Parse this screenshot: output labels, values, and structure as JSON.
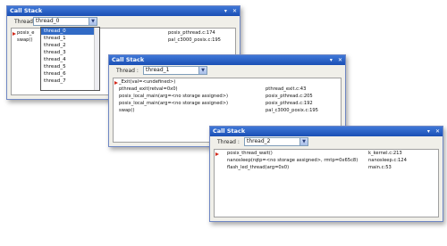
{
  "win1": {
    "title": "Call Stack",
    "thread_label": "Thread :",
    "selected_thread": "thread_0",
    "dropdown_items": [
      "thread_0",
      "thread_1",
      "thread_2",
      "thread_3",
      "thread_4",
      "thread_5",
      "thread_6",
      "thread_7"
    ],
    "rows": [
      {
        "fn": "posix_e",
        "loc": "posix_pthread.c:174"
      },
      {
        "fn": "swap()",
        "loc": "pal_c3000_posix.c:195"
      }
    ]
  },
  "win2": {
    "title": "Call Stack",
    "thread_label": "Thread :",
    "selected_thread": "thread_1",
    "rows": [
      {
        "fn": "_Exit(val=<undefined>)",
        "loc": ""
      },
      {
        "fn": "pthread_exit(retval=0x0)",
        "loc": "pthread_exit.c:43"
      },
      {
        "fn": "posix_local_main(arg=<no storage assigned>)",
        "loc": "posix_pthread.c:205"
      },
      {
        "fn": "posix_local_main(arg=<no storage assigned>)",
        "loc": "posix_pthread.c:192"
      },
      {
        "fn": "swap()",
        "loc": "pal_c3000_posix.c:195"
      }
    ]
  },
  "win3": {
    "title": "Call Stack",
    "thread_label": "Thread :",
    "selected_thread": "thread_2",
    "rows": [
      {
        "fn": "posix_thread_wait()",
        "loc": "k_kernel.c:213"
      },
      {
        "fn": "nanosleep(rqtp=<no storage assigned>, rmtp=0x65c8)",
        "loc": "nanosleep.c:124"
      },
      {
        "fn": "flash_led_thread(arg=0x0)",
        "loc": "main.c:53"
      }
    ]
  },
  "icons": {
    "combo_arrow": "chevron-down-icon",
    "pin": "pin-icon",
    "close": "close-icon",
    "current_frame": "current-frame-arrow-icon"
  },
  "glyphs": {
    "combo_arrow": "▼",
    "pin": "▾",
    "close": "✕"
  },
  "colors": {
    "titlebar": "#1f58c2",
    "current_frame_arrow": "#d12a1b",
    "selected_item": "#316ac5"
  }
}
